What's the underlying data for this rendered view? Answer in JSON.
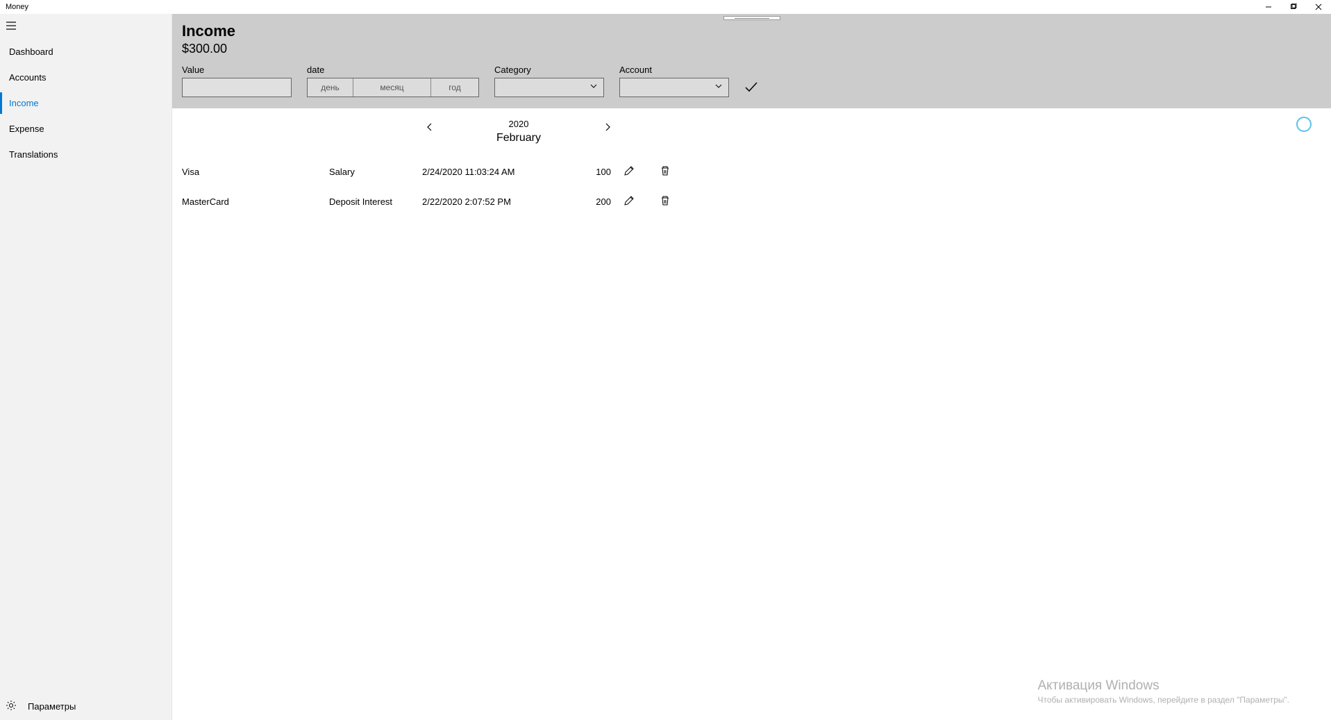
{
  "window": {
    "title": "Money"
  },
  "sidebar": {
    "items": [
      {
        "label": "Dashboard"
      },
      {
        "label": "Accounts"
      },
      {
        "label": "Income"
      },
      {
        "label": "Expense"
      },
      {
        "label": "Translations"
      }
    ],
    "settings_label": "Параметры"
  },
  "header": {
    "title": "Income",
    "total": "$300.00",
    "form": {
      "value_label": "Value",
      "date_label": "date",
      "date_day": "день",
      "date_month": "месяц",
      "date_year": "год",
      "category_label": "Category",
      "account_label": "Account"
    }
  },
  "month_nav": {
    "year": "2020",
    "month": "February"
  },
  "records": [
    {
      "account": "Visa",
      "category": "Salary",
      "date": "2/24/2020 11:03:24 AM",
      "amount": "100"
    },
    {
      "account": "MasterCard",
      "category": "Deposit Interest",
      "date": "2/22/2020 2:07:52 PM",
      "amount": "200"
    }
  ],
  "watermark": {
    "title": "Активация Windows",
    "sub": "Чтобы активировать Windows, перейдите в раздел \"Параметры\"."
  }
}
